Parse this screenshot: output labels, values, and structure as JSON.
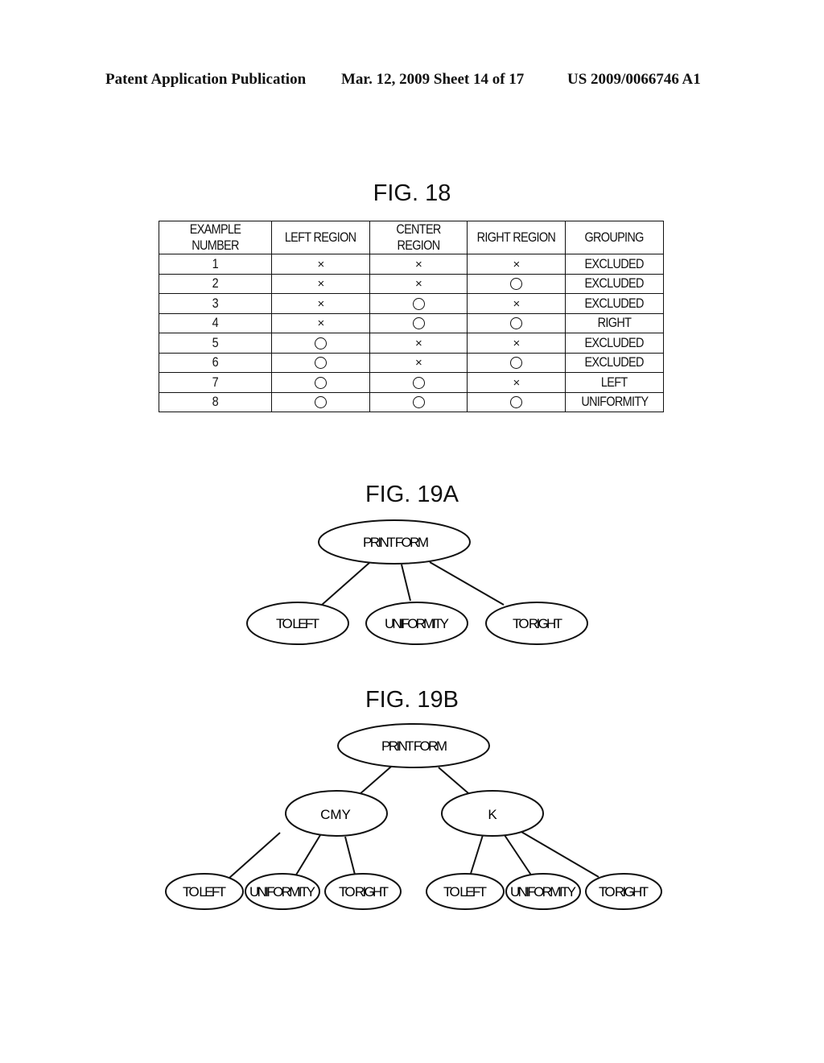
{
  "header": {
    "publication": "Patent Application Publication",
    "date_sheet": "Mar. 12, 2009  Sheet 14 of 17",
    "number": "US 2009/0066746 A1"
  },
  "fig18": {
    "title": "FIG. 18",
    "columns": [
      "EXAMPLE NUMBER",
      "LEFT REGION",
      "CENTER REGION",
      "RIGHT REGION",
      "GROUPING"
    ],
    "rows": [
      {
        "number": "1",
        "left": "x",
        "center": "x",
        "right": "x",
        "grouping": "EXCLUDED"
      },
      {
        "number": "2",
        "left": "x",
        "center": "x",
        "right": "o",
        "grouping": "EXCLUDED"
      },
      {
        "number": "3",
        "left": "x",
        "center": "o",
        "right": "x",
        "grouping": "EXCLUDED"
      },
      {
        "number": "4",
        "left": "x",
        "center": "o",
        "right": "o",
        "grouping": "RIGHT"
      },
      {
        "number": "5",
        "left": "o",
        "center": "x",
        "right": "x",
        "grouping": "EXCLUDED"
      },
      {
        "number": "6",
        "left": "o",
        "center": "x",
        "right": "o",
        "grouping": "EXCLUDED"
      },
      {
        "number": "7",
        "left": "o",
        "center": "o",
        "right": "x",
        "grouping": "LEFT"
      },
      {
        "number": "8",
        "left": "o",
        "center": "o",
        "right": "o",
        "grouping": "UNIFORMITY"
      }
    ],
    "symbols": {
      "x": "×",
      "o": "circle"
    }
  },
  "fig19a": {
    "title": "FIG. 19A",
    "root": "PRINT FORM",
    "children": [
      "TO LEFT",
      "UNIFORMITY",
      "TO RIGHT"
    ]
  },
  "fig19b": {
    "title": "FIG. 19B",
    "root": "PRINT FORM",
    "branches": [
      {
        "label": "CMY",
        "children": [
          "TO LEFT",
          "UNIFORMITY",
          "TO RIGHT"
        ]
      },
      {
        "label": "K",
        "children": [
          "TO LEFT",
          "UNIFORMITY",
          "TO RIGHT"
        ]
      }
    ]
  }
}
